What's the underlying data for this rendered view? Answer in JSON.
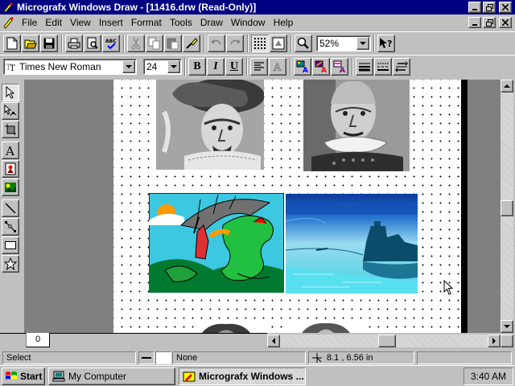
{
  "window": {
    "title": "Micrografx Windows Draw - [11416.drw (Read-Only)]"
  },
  "menu": {
    "items": [
      "File",
      "Edit",
      "View",
      "Insert",
      "Format",
      "Tools",
      "Draw",
      "Window",
      "Help"
    ]
  },
  "toolbar": {
    "zoom_value": "52%"
  },
  "format_bar": {
    "font_name": "Times New Roman",
    "font_size": "24",
    "bold_label": "B",
    "italic_label": "I",
    "underline_label": "U"
  },
  "canvas": {
    "page_tab": "0"
  },
  "status": {
    "mode": "Select",
    "fill": "None",
    "coords": "8.1 , 6.56 in"
  },
  "taskbar": {
    "start_label": "Start",
    "tasks": [
      "My Computer",
      "Micrografx Windows ..."
    ],
    "clock": "3:40 AM"
  },
  "colors": {
    "titlebar": "#000080",
    "face": "#c0c0c0",
    "workspace": "#808080",
    "page_shadow": "#000000"
  },
  "icons": {
    "palette": [
      "arrow-select-icon",
      "node-edit-icon",
      "crop-icon",
      "text-icon",
      "symbol-icon",
      "clipart-icon",
      "line-icon",
      "curve-icon",
      "rectangle-icon",
      "star-icon"
    ]
  }
}
